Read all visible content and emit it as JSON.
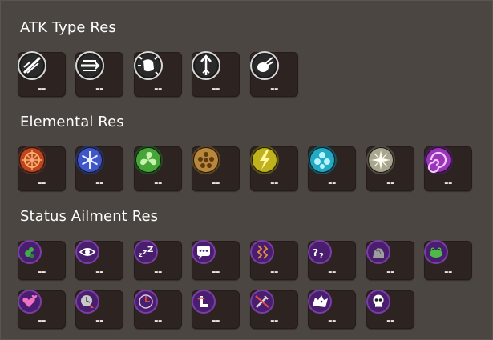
{
  "sections": {
    "atk": {
      "title": "ATK Type Res"
    },
    "elemental": {
      "title": "Elemental Res"
    },
    "status": {
      "title": "Status Ailment Res"
    }
  },
  "atk_items": [
    {
      "icon": "slash-icon",
      "value": "--"
    },
    {
      "icon": "pierce-icon",
      "value": "--"
    },
    {
      "icon": "strike-icon",
      "value": "--"
    },
    {
      "icon": "arrow-icon",
      "value": "--"
    },
    {
      "icon": "missile-icon",
      "value": "--"
    }
  ],
  "elemental_items": [
    {
      "icon": "fire-icon",
      "value": "--",
      "color": "#c4441a"
    },
    {
      "icon": "ice-icon",
      "value": "--",
      "color": "#3f56c8"
    },
    {
      "icon": "wind-icon",
      "value": "--",
      "color": "#45a637"
    },
    {
      "icon": "earth-icon",
      "value": "--",
      "color": "#b9873c"
    },
    {
      "icon": "lightning-icon",
      "value": "--",
      "color": "#c0b21c"
    },
    {
      "icon": "water-icon",
      "value": "--",
      "color": "#22a9c4"
    },
    {
      "icon": "light-icon",
      "value": "--",
      "color": "#a9a58f"
    },
    {
      "icon": "dark-icon",
      "value": "--",
      "color": "#9a35b8"
    }
  ],
  "status_items": [
    {
      "icon": "poison-icon",
      "value": "--"
    },
    {
      "icon": "blind-icon",
      "value": "--"
    },
    {
      "icon": "sleep-icon",
      "value": "--"
    },
    {
      "icon": "silence-icon",
      "value": "--"
    },
    {
      "icon": "paralyze-icon",
      "value": "--"
    },
    {
      "icon": "confuse-icon",
      "value": "--"
    },
    {
      "icon": "petrify-icon",
      "value": "--"
    },
    {
      "icon": "toad-icon",
      "value": "--"
    },
    {
      "icon": "charm-icon",
      "value": "--"
    },
    {
      "icon": "slow-icon",
      "value": "--"
    },
    {
      "icon": "stop-icon",
      "value": "--"
    },
    {
      "icon": "immobilize-icon",
      "value": "--"
    },
    {
      "icon": "disable-icon",
      "value": "--"
    },
    {
      "icon": "berserk-icon",
      "value": "--"
    },
    {
      "icon": "doom-icon",
      "value": "--"
    }
  ],
  "colors": {
    "background": "#4b4641",
    "tile": "#2d2422",
    "status_orb": "#4a1e6e"
  }
}
